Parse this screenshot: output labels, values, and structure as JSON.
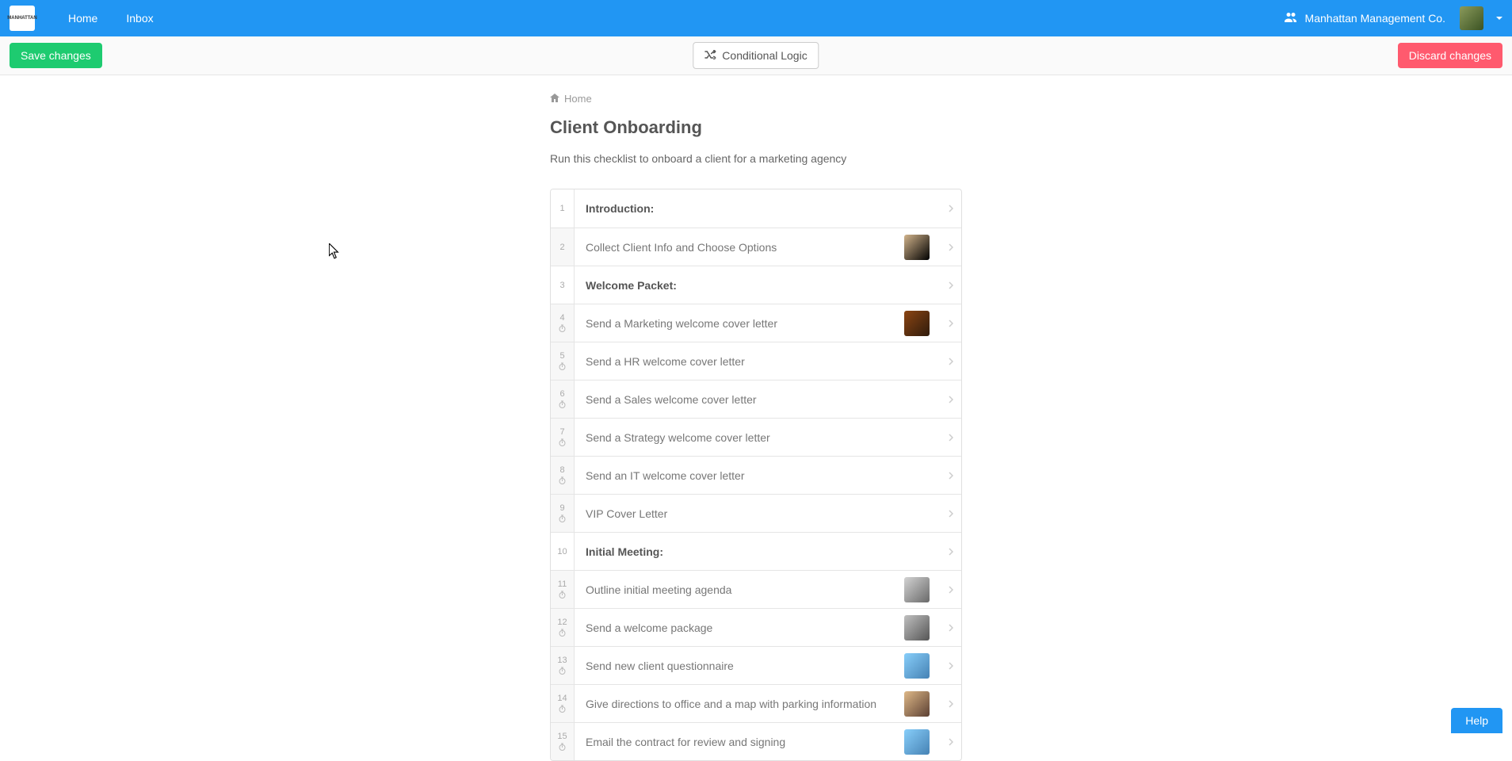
{
  "nav": {
    "logo_text": "MANHATTAN",
    "home": "Home",
    "inbox": "Inbox",
    "org_name": "Manhattan Management Co."
  },
  "actions": {
    "save": "Save changes",
    "conditional_logic": "Conditional Logic",
    "discard": "Discard changes"
  },
  "breadcrumb": {
    "home": "Home"
  },
  "page": {
    "title": "Client Onboarding",
    "description": "Run this checklist to onboard a client for a marketing agency"
  },
  "steps": [
    {
      "num": "1",
      "label": "Introduction:",
      "header": true,
      "clock": false,
      "avatar": null
    },
    {
      "num": "2",
      "label": "Collect Client Info and Choose Options",
      "header": false,
      "clock": false,
      "avatar": "avatar-f1"
    },
    {
      "num": "3",
      "label": "Welcome Packet:",
      "header": true,
      "clock": false,
      "avatar": null
    },
    {
      "num": "4",
      "label": "Send a Marketing welcome cover letter",
      "header": false,
      "clock": true,
      "avatar": "avatar-f2"
    },
    {
      "num": "5",
      "label": "Send a HR welcome cover letter",
      "header": false,
      "clock": true,
      "avatar": null
    },
    {
      "num": "6",
      "label": "Send a Sales welcome cover letter",
      "header": false,
      "clock": true,
      "avatar": null
    },
    {
      "num": "7",
      "label": "Send a Strategy welcome cover letter",
      "header": false,
      "clock": true,
      "avatar": null
    },
    {
      "num": "8",
      "label": "Send an IT welcome cover letter",
      "header": false,
      "clock": true,
      "avatar": null
    },
    {
      "num": "9",
      "label": "VIP Cover Letter",
      "header": false,
      "clock": true,
      "avatar": null
    },
    {
      "num": "10",
      "label": "Initial Meeting:",
      "header": true,
      "clock": false,
      "avatar": null
    },
    {
      "num": "11",
      "label": "Outline initial meeting agenda",
      "header": false,
      "clock": true,
      "avatar": "avatar-m1"
    },
    {
      "num": "12",
      "label": "Send a welcome package",
      "header": false,
      "clock": true,
      "avatar": "avatar-m2"
    },
    {
      "num": "13",
      "label": "Send new client questionnaire",
      "header": false,
      "clock": true,
      "avatar": "avatar-m3"
    },
    {
      "num": "14",
      "label": "Give directions to office and a map with parking information",
      "header": false,
      "clock": true,
      "avatar": "avatar-f3"
    },
    {
      "num": "15",
      "label": "Email the contract for review and signing",
      "header": false,
      "clock": true,
      "avatar": "avatar-m3"
    }
  ],
  "help": "Help"
}
